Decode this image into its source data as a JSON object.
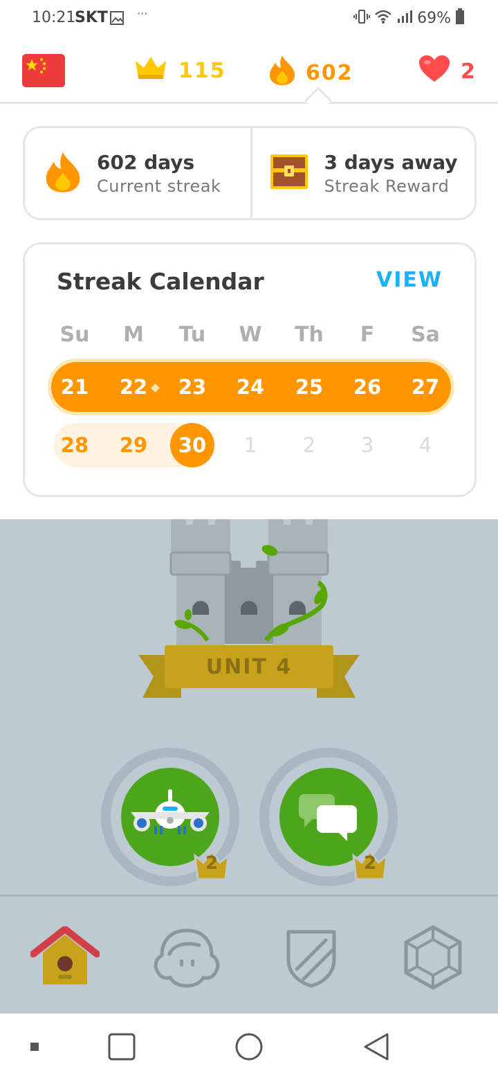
{
  "status_bar": {
    "time": "10:21",
    "carrier": "SKT",
    "battery": "69%"
  },
  "topbar": {
    "flag": "china-flag",
    "crowns": "115",
    "streak": "602",
    "hearts": "2"
  },
  "summary": {
    "streak_title": "602 days",
    "streak_sub": "Current streak",
    "reward_title": "3 days away",
    "reward_sub": "Streak Reward"
  },
  "calendar": {
    "title": "Streak Calendar",
    "view_label": "VIEW",
    "weekdays": [
      "Su",
      "M",
      "Tu",
      "W",
      "Th",
      "F",
      "Sa"
    ],
    "week1": [
      "21",
      "22",
      "23",
      "24",
      "25",
      "26",
      "27"
    ],
    "week2": [
      "28",
      "29",
      "30",
      "1",
      "2",
      "3",
      "4"
    ],
    "today": "30"
  },
  "course": {
    "unit_label": "UNIT 4",
    "skills": [
      {
        "icon": "airplane-icon",
        "crown_level": "2"
      },
      {
        "icon": "chat-bubbles-icon",
        "crown_level": "2"
      }
    ]
  },
  "bottom_nav": [
    "home-icon",
    "profile-icon",
    "leagues-shield-icon",
    "shop-gem-icon"
  ],
  "colors": {
    "orange": "#ff9600",
    "gold": "#ffc800",
    "red": "#ff4b4b",
    "blue": "#1cb0f6",
    "green": "#4da51c",
    "course_bg": "#bdcad1"
  }
}
